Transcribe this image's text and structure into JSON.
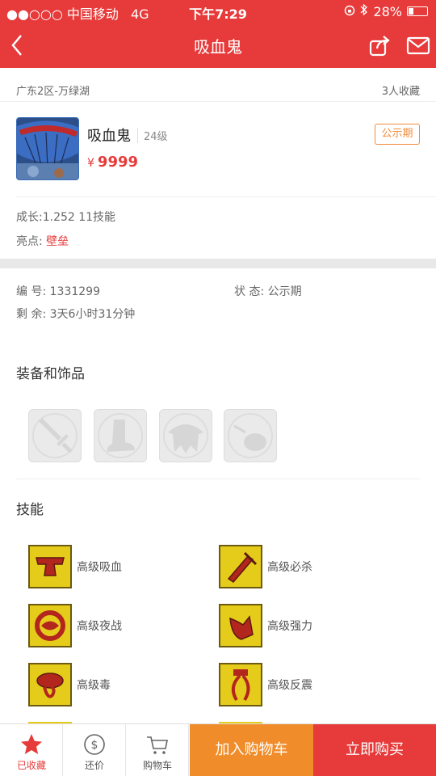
{
  "status_bar": {
    "carrier": "●●○○○ 中国移动",
    "network": "4G",
    "time": "下午7:29",
    "battery": "28%",
    "battery_level": 0.28
  },
  "nav": {
    "title": "吸血鬼"
  },
  "listing": {
    "location": "广东2区-万绿湖",
    "favorites": "3人收藏"
  },
  "pet": {
    "name": "吸血鬼",
    "level": "24级",
    "currency": "¥",
    "price": "9999",
    "status_badge": "公示期"
  },
  "attributes": {
    "growth": "成长:1.252 11技能",
    "highlight_label": "亮点:",
    "highlight_value": "壁垒"
  },
  "details": {
    "id_label": "编 号:",
    "id_value": "1331299",
    "status_label": "状 态:",
    "status_value": "公示期",
    "remain_label": "剩 余:",
    "remain_value": "3天6小时31分钟"
  },
  "sections": {
    "equipment": "装备和饰品",
    "skills": "技能"
  },
  "equipment": [
    {
      "icon": "sword-icon"
    },
    {
      "icon": "boot-icon"
    },
    {
      "icon": "armor-icon"
    },
    {
      "icon": "accessory-icon"
    }
  ],
  "skills": [
    {
      "label": "高级吸血",
      "icon": "blood-suck-icon"
    },
    {
      "label": "高级必杀",
      "icon": "critical-sword-icon"
    },
    {
      "label": "高级夜战",
      "icon": "night-eye-icon"
    },
    {
      "label": "高级强力",
      "icon": "strength-arm-icon"
    },
    {
      "label": "高级毒",
      "icon": "poison-snake-icon"
    },
    {
      "label": "高级反震",
      "icon": "counter-shock-icon"
    }
  ],
  "bottom_bar": {
    "favorited": "已收藏",
    "bargain": "还价",
    "cart": "购物车",
    "add_to_cart": "加入购物车",
    "buy_now": "立即购买"
  },
  "colors": {
    "primary": "#e73a3a",
    "accent": "#f08c2a",
    "skill_bg": "#e6cc1a"
  }
}
